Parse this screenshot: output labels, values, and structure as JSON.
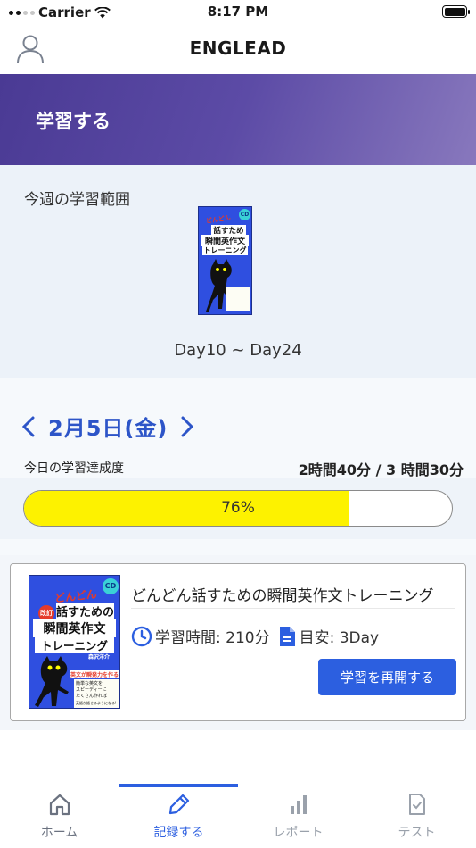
{
  "status_bar": {
    "carrier": "Carrier",
    "time": "8:17 PM"
  },
  "nav": {
    "title": "ENGLEAD",
    "profile_icon": "person-icon"
  },
  "hero": {
    "title": "学習する"
  },
  "week": {
    "label": "今週の学習範囲",
    "range": "Day10 ~ Day24"
  },
  "progress": {
    "date": "2月5日(金)",
    "label": "今日の学習達成度",
    "time_total": "2時間40分 / 3 時間30分",
    "percent_label": "76%",
    "percent_value": 76
  },
  "book_cover": {
    "cd": "CD",
    "kana": "どんどん",
    "badge": "改訂",
    "line1": "話すための",
    "line2": "瞬間英作文",
    "line3": "トレーニング",
    "author": "森沢洋介",
    "tagline": "英文が瞬発力を作る",
    "copy1": "簡単な英文を",
    "copy2": "スピーディーに",
    "copy3": "たくさん作れば",
    "copy4": "英語が話せるようになる!"
  },
  "card": {
    "title": "どんどん話すための瞬間英作文トレーニング",
    "study_time": "学習時間: 210分",
    "target": "目安: 3Day",
    "resume_button": "学習を再開する"
  },
  "tabs": [
    {
      "label": "ホーム",
      "icon": "home-icon"
    },
    {
      "label": "記録する",
      "icon": "pencil-icon"
    },
    {
      "label": "レポート",
      "icon": "bar-chart-icon"
    },
    {
      "label": "テスト",
      "icon": "document-check-icon"
    }
  ],
  "colors": {
    "accent": "#2c5fe0",
    "hero_start": "#4a3a94",
    "hero_end": "#8878bd",
    "progress_fill": "#fdf200",
    "book_blue": "#2f4fe0"
  }
}
